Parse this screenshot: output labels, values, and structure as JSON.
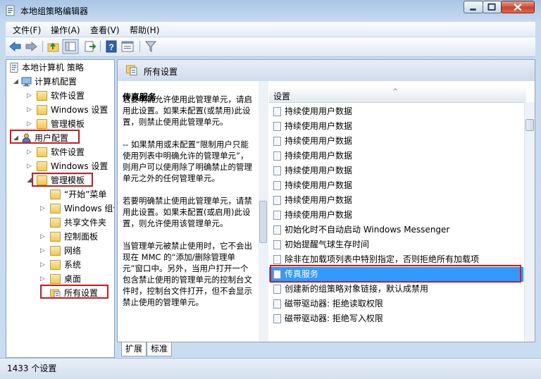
{
  "window": {
    "title": "本地组策略编辑器"
  },
  "menu": [
    "文件(F)",
    "操作(A)",
    "查看(V)",
    "帮助(H)"
  ],
  "toolbar_icons": [
    "back-arrow-icon",
    "forward-arrow-icon",
    "up-folder-icon",
    "show-hide-tree-icon",
    "export-list-icon",
    "help-icon",
    "properties-icon",
    "filter-icon"
  ],
  "tree": {
    "root": "本地计算机 策略",
    "computer": "计算机配置",
    "computer_children": [
      "软件设置",
      "Windows 设置",
      "管理模板"
    ],
    "user": "用户配置",
    "user_children": [
      "软件设置",
      "Windows 设置",
      "管理模板"
    ],
    "admin_children": [
      "“开始”菜单",
      "Windows 组件",
      "共享文件夹",
      "控制面板",
      "网络",
      "系统",
      "桌面",
      "所有设置"
    ]
  },
  "right_header": "所有设置",
  "description": {
    "title": "传真服务",
    "body": "若要明确允许使用此管理单元，请启用此设置。如果未配置(或禁用)此设置，则禁止使用此管理单元。\n\n-- 如果禁用或未配置“限制用户只能使用列表中明确允许的管理单元”，则用户可以使用除了明确禁止的管理单元之外的任何管理单元。\n\n若要明确禁止使用此管理单元，请禁用此设置。如果未配置(或启用)此设置，则允许使用该管理单元。\n\n当管理单元被禁止使用时，它不会出现在 MMC 的“添加/删除管理单元”窗口中。另外，当用户打开一个包含禁止使用的管理单元的控制台文件时，控制台文件打开，但不会显示禁止使用的管理单元。"
  },
  "list": {
    "header": "设置",
    "sort_arrow": "^",
    "items": [
      "持续使用用户数据",
      "持续使用用户数据",
      "持续使用用户数据",
      "持续使用用户数据",
      "持续使用用户数据",
      "持续使用用户数据",
      "持续使用用户数据",
      "持续使用用户数据",
      "初始化时不自动启动 Windows Messenger",
      "初始提醒气球生存时间",
      "除非在加载项列表中特别指定，否则拒绝所有加载项",
      "传真服务",
      "创建新的组策略对象链接，默认成禁用",
      "磁带驱动器: 拒绝读取权限",
      "磁带驱动器: 拒绝写入权限"
    ],
    "selected_index": 11
  },
  "tabs": [
    "扩展",
    "标准"
  ],
  "status": "1433 个设置",
  "colors": {
    "highlight": "#e0161c",
    "selection": "#3399ff"
  }
}
